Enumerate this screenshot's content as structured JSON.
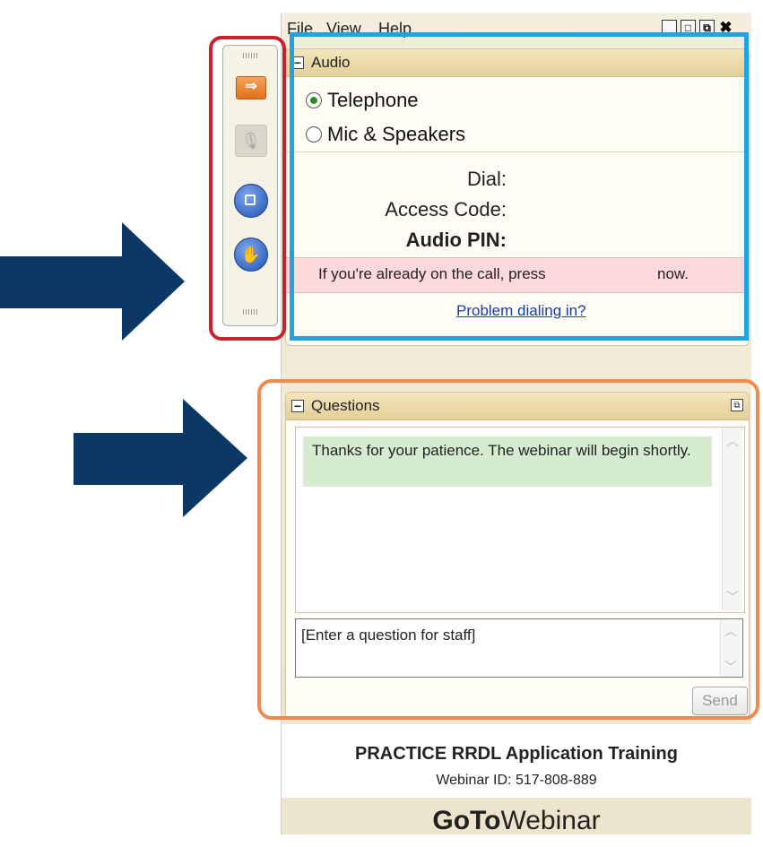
{
  "menu": {
    "file": "File",
    "view": "View",
    "help": "Help"
  },
  "audio": {
    "header": "Audio",
    "option_telephone": "Telephone",
    "option_mic": "Mic & Speakers",
    "selected": "Telephone",
    "dial_label": "Dial:",
    "access_code_label": "Access Code:",
    "audio_pin_label": "Audio PIN:",
    "notice_text": "If you're already on the call, press",
    "notice_suffix": "now.",
    "problem_link": "Problem dialing in?"
  },
  "questions": {
    "header": "Questions",
    "message": "Thanks for your patience.  The webinar will begin shortly.",
    "input_placeholder": "[Enter a question for staff]",
    "send_label": "Send"
  },
  "footer": {
    "title": "PRACTICE RRDL Application Training",
    "webinar_id": "Webinar ID: 517-808-889"
  },
  "brand": {
    "part1": "GoTo",
    "part2": "Webinar"
  },
  "annotation_colors": {
    "sidebar_box": "#cc1f2a",
    "audio_box": "#21a3e0",
    "questions_box": "#ee8a4e",
    "arrows": "#0c3866"
  },
  "sidebar_icons": [
    "arrow-right-icon",
    "microphone-icon",
    "stop-screen-icon",
    "raise-hand-icon"
  ]
}
